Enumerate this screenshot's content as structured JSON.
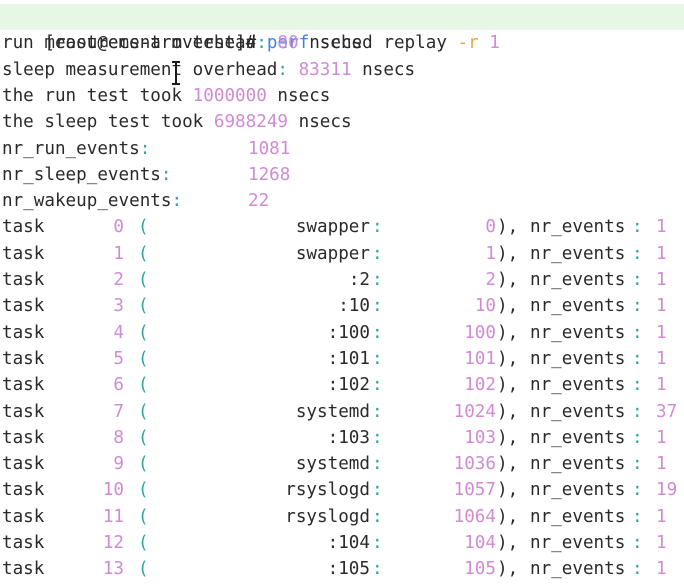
{
  "terminal": {
    "prompt": {
      "user_host": "[root@ecs-arm test]#",
      "command": "perf",
      "args": "sched replay",
      "flag": "-r",
      "flag_value": "1"
    },
    "summary_lines": [
      {
        "label": "run measurement overhead",
        "value": "80",
        "unit": "nsecs"
      },
      {
        "label": "sleep measurement overhead",
        "value": "83311",
        "unit": "nsecs"
      },
      {
        "label": "the run test took",
        "value": "1000000",
        "unit": "nsecs"
      },
      {
        "label": "the sleep test took",
        "value": "6988249",
        "unit": "nsecs"
      }
    ],
    "counters": [
      {
        "label": "nr_run_events",
        "value": "1081"
      },
      {
        "label": "nr_sleep_events",
        "value": "1268"
      },
      {
        "label": "nr_wakeup_events",
        "value": "22"
      }
    ],
    "task_word": "task",
    "events_label": "nr_events",
    "tasks": [
      {
        "id": "0",
        "name": "swapper",
        "pid": "0",
        "events": "1"
      },
      {
        "id": "1",
        "name": "swapper",
        "pid": "1",
        "events": "1"
      },
      {
        "id": "2",
        "name": ":2",
        "pid": "2",
        "events": "1"
      },
      {
        "id": "3",
        "name": ":10",
        "pid": "10",
        "events": "1"
      },
      {
        "id": "4",
        "name": ":100",
        "pid": "100",
        "events": "1"
      },
      {
        "id": "5",
        "name": ":101",
        "pid": "101",
        "events": "1"
      },
      {
        "id": "6",
        "name": ":102",
        "pid": "102",
        "events": "1"
      },
      {
        "id": "7",
        "name": "systemd",
        "pid": "1024",
        "events": "37"
      },
      {
        "id": "8",
        "name": ":103",
        "pid": "103",
        "events": "1"
      },
      {
        "id": "9",
        "name": "systemd",
        "pid": "1036",
        "events": "1"
      },
      {
        "id": "10",
        "name": "rsyslogd",
        "pid": "1057",
        "events": "19"
      },
      {
        "id": "11",
        "name": "rsyslogd",
        "pid": "1064",
        "events": "1"
      },
      {
        "id": "12",
        "name": ":104",
        "pid": "104",
        "events": "1"
      },
      {
        "id": "13",
        "name": ":105",
        "pid": "105",
        "events": "1"
      }
    ],
    "colors": {
      "background": "#ffffff",
      "prompt_highlight": "#e6f7e6",
      "command": "#3c84e8",
      "flag": "#e8a93c",
      "number": "#d08bd4",
      "punctuation": "#30a69b",
      "text": "#2a2a2a"
    },
    "cursor_icon": "text-cursor-ibeam"
  }
}
